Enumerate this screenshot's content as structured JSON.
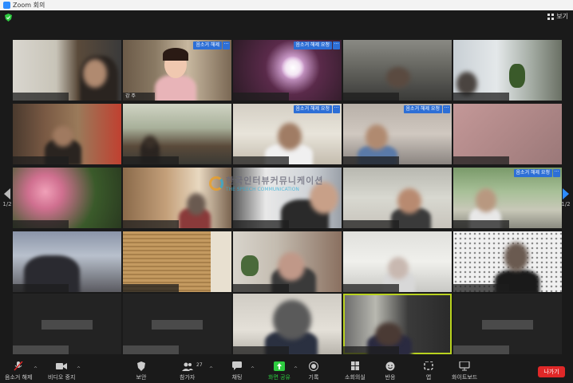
{
  "window": {
    "title": "Zoom 회의"
  },
  "top": {
    "view_label": "보기"
  },
  "pagination": {
    "left": "1/2",
    "right": "1/2"
  },
  "watermark": {
    "korean": "한국인터뷰커뮤니케이션",
    "english": "THE SPEECH COMMUNICATION"
  },
  "tiles": {
    "t1": {
      "name": ""
    },
    "t2": {
      "name": "강 주",
      "unmute": "음소거 해제",
      "more": "···"
    },
    "t3": {
      "unmute": "음소거 해제 요청",
      "more": "···"
    },
    "t8": {
      "unmute": "음소거 해제 요청",
      "more": "···"
    },
    "t9": {
      "unmute": "음소거 해제 요청",
      "more": "···"
    },
    "t15": {
      "unmute": "음소거 해제 요청",
      "more": "···"
    }
  },
  "toolbar": {
    "mute": "음소거 해제",
    "video": "비디오 중지",
    "security": "보안",
    "participants": "참가자",
    "participants_count": "27",
    "chat": "채팅",
    "share": "화면 공유",
    "record": "기록",
    "breakout": "소회의실",
    "reactions": "반응",
    "apps": "앱",
    "whiteboard": "화이트보드",
    "leave": "나가기"
  },
  "colors": {
    "accent": "#2d8cff",
    "share_green": "#2ecc40",
    "leave_red": "#e02828",
    "active_border": "#b9d21f"
  }
}
